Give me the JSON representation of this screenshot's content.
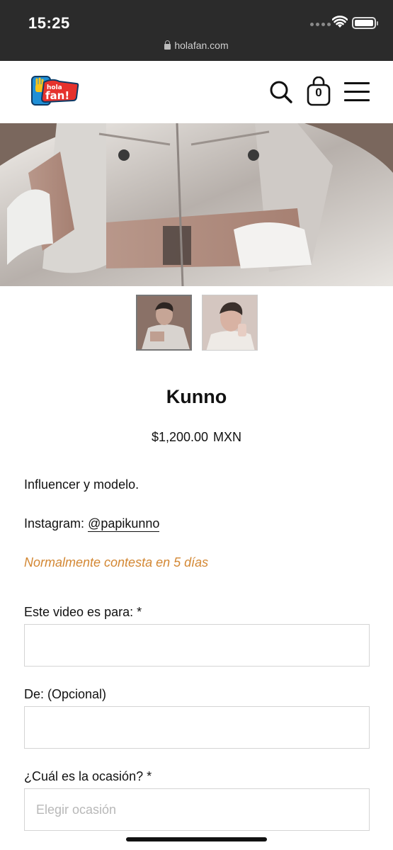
{
  "status_bar": {
    "time": "15:25",
    "url": "holafan.com"
  },
  "header": {
    "logo_text": "hola fan!",
    "cart_count": "0",
    "brand_colors": {
      "logo_blue": "#1f8fd6",
      "logo_red": "#e5322d",
      "logo_yellow": "#f7c31a"
    }
  },
  "gallery": {
    "hero_alt": "Kunno",
    "thumbnails": [
      "thumbnail-1",
      "thumbnail-2"
    ],
    "active_index": 0
  },
  "product": {
    "name": "Kunno",
    "price": "$1,200.00",
    "currency": "MXN",
    "description": "Influencer y modelo.",
    "instagram_label": "Instagram:",
    "instagram_handle": "@papikunno",
    "response_note": "Normalmente contesta en 5 días",
    "accent_color": "#d38733"
  },
  "form": {
    "for_label": "Este video es para: *",
    "for_value": "",
    "from_label": "De: (Opcional)",
    "from_value": "",
    "occasion_label": "¿Cuál es la ocasión? *",
    "occasion_placeholder": "Elegir ocasión"
  }
}
